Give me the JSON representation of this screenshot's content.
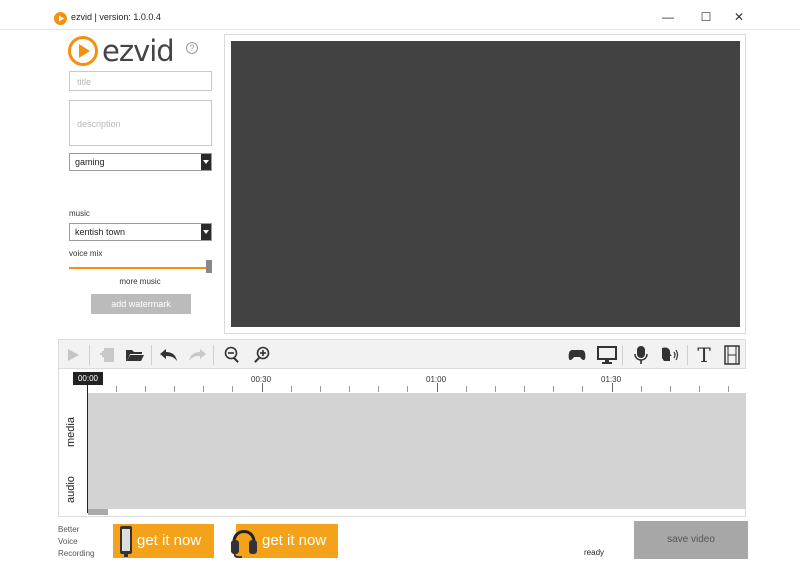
{
  "window": {
    "title": "ezvid | version: 1.0.0.4",
    "minimize": "—",
    "maximize": "☐",
    "close": "✕"
  },
  "logo": {
    "text": "ezvid",
    "help": "?"
  },
  "form": {
    "title_placeholder": "title",
    "description_placeholder": "description",
    "category_value": "gaming",
    "music_label": "music",
    "music_value": "kentish town",
    "voice_mix_label": "voice mix",
    "voice_mix_level": 1.0,
    "more_music": "more music",
    "add_watermark": "add watermark"
  },
  "toolbar": {
    "left_icons": [
      "play-icon",
      "add-clip-icon",
      "open-folder-icon",
      "undo-icon",
      "redo-icon",
      "zoom-out-icon",
      "zoom-in-icon"
    ],
    "right_icons": [
      "gamepad-icon",
      "monitor-icon",
      "microphone-icon",
      "voice-speak-icon",
      "text-icon",
      "film-icon"
    ]
  },
  "timeline": {
    "cursor_time": "00:00",
    "ticks": [
      "00:30",
      "01:00",
      "01:30"
    ],
    "tracks": [
      "media",
      "audio"
    ]
  },
  "footer": {
    "promo_lines": [
      "Better",
      "Voice",
      "Recording"
    ],
    "promo1": "get it now",
    "promo2": "get it now",
    "status": "ready",
    "save_video": "save video"
  },
  "colors": {
    "accent": "#f4900c",
    "preview_bg": "#424242",
    "track_bg": "#d3d3d3"
  }
}
